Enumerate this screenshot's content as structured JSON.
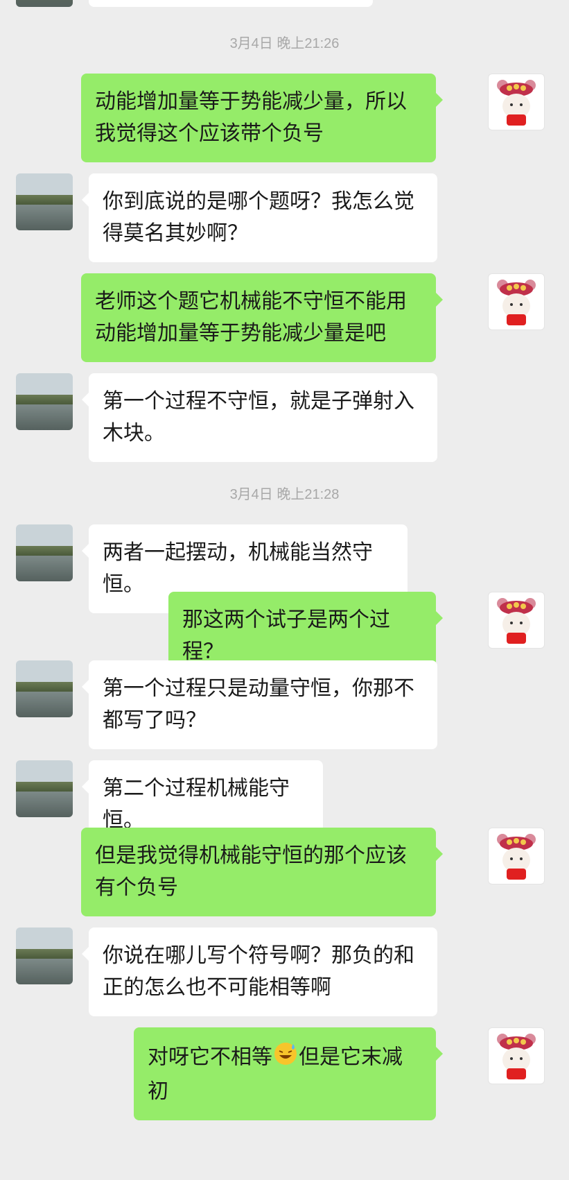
{
  "timestamps": [
    "3月4日 晚上21:26",
    "3月4日 晚上21:28"
  ],
  "messages": [
    {
      "side": "right",
      "text": "动能增加量等于势能减少量，所以我觉得这个应该带个负号"
    },
    {
      "side": "left",
      "text": "你到底说的是哪个题呀？我怎么觉得莫名其妙啊？"
    },
    {
      "side": "right",
      "text": "老师这个题它机械能不守恒不能用动能增加量等于势能减少量是吧"
    },
    {
      "side": "left",
      "text": "第一个过程不守恒，就是子弹射入木块。"
    },
    {
      "side": "left",
      "text": "两者一起摆动，机械能当然守恒。"
    },
    {
      "side": "right",
      "text": "那这两个试子是两个过程？"
    },
    {
      "side": "left",
      "text": "第一个过程只是动量守恒，你那不都写了吗？"
    },
    {
      "side": "left",
      "text": "第二个过程机械能守恒。"
    },
    {
      "side": "right",
      "text": "但是我觉得机械能守恒的那个应该有个负号"
    },
    {
      "side": "left",
      "text": "你说在哪儿写个符号啊？那负的和正的怎么也不可能相等啊"
    },
    {
      "side": "right",
      "text_before": "对呀它不相等",
      "emoji": "sweat-laugh-emoji",
      "text_after": "但是它末减初"
    }
  ],
  "avatars": {
    "left": "landscape-photo-avatar",
    "right": "cartoon-girl-avatar"
  },
  "colors": {
    "background": "#ededed",
    "incoming_bubble": "#ffffff",
    "outgoing_bubble": "#95ec69",
    "timestamp": "#a8a8a8"
  }
}
